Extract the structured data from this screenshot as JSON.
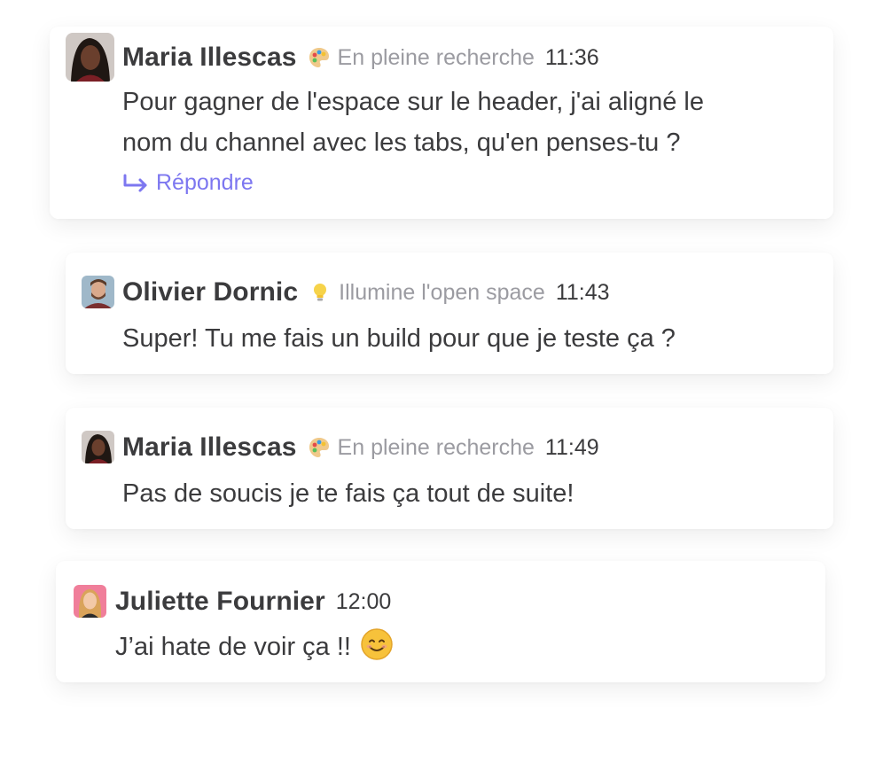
{
  "messages": [
    {
      "author": "Maria Illescas",
      "status_icon": "palette-icon",
      "status": "En pleine recherche",
      "time": "11:36",
      "text_line1": "Pour gagner de l'espace sur le header, j'ai aligné le",
      "text_line2": "nom du channel avec les tabs, qu'en penses-tu ?",
      "reply_label": "Répondre"
    },
    {
      "author": "Olivier Dornic",
      "status_icon": "lightbulb-icon",
      "status": "Illumine l'open space",
      "time": "11:43",
      "text": "Super! Tu me fais un build pour que je teste ça ?"
    },
    {
      "author": "Maria Illescas",
      "status_icon": "palette-icon",
      "status": "En pleine recherche",
      "time": "11:49",
      "text": "Pas de soucis je te fais ça tout de suite!"
    },
    {
      "author": "Juliette Fournier",
      "time": "12:00",
      "text": "J’ai hate de voir ça !!",
      "emoji": "smiling-face-emoji"
    }
  ],
  "colors": {
    "accent": "#7d77f0",
    "status_text": "#9b9ba1",
    "text": "#3b3b3d"
  }
}
